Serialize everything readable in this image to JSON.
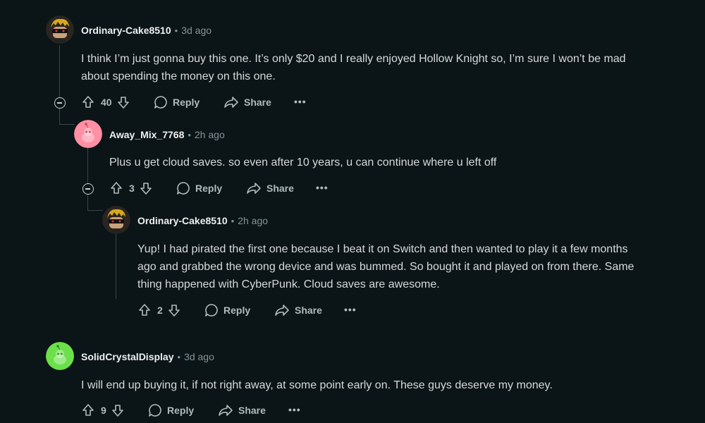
{
  "comments": [
    {
      "username": "Ordinary-Cake8510",
      "time": "3d ago",
      "lines": [
        "I think I’m just gonna buy this one. It’s only $20 and I really enjoyed Hollow Knight so, I’m sure I won’t be mad",
        "about spending the money on this one."
      ],
      "votes": "40",
      "avatar": "sunglasses-avatar"
    },
    {
      "username": "Away_Mix_7768",
      "time": "2h ago",
      "lines": [
        "Plus u get cloud saves. so even after 10 years, u can continue where u left off"
      ],
      "votes": "3",
      "avatar": "snoo-pink-avatar"
    },
    {
      "username": "Ordinary-Cake8510",
      "time": "2h ago",
      "lines": [
        "Yup! I had pirated the first one because I beat it on Switch and then wanted to play it a few months",
        "ago and grabbed the wrong device and was bummed. So bought it and played on from there. Same",
        "thing happened with CyberPunk. Cloud saves are awesome."
      ],
      "votes": "2",
      "avatar": "sunglasses-avatar"
    },
    {
      "username": "SolidCrystalDisplay",
      "time": "3d ago",
      "lines": [
        "I will end up buying it, if not right away, at some point early on. These guys deserve my money."
      ],
      "votes": "9",
      "avatar": "snoo-green-avatar"
    }
  ],
  "labels": {
    "reply": "Reply",
    "share": "Share",
    "more": "•••",
    "separator": "•"
  },
  "colors": {
    "background": "#0b1416",
    "text": "#d7dadc",
    "meta": "#82959b",
    "thread_line": "#3a4447",
    "pink_avatar": "#ff8fa3",
    "green_avatar": "#6be04a"
  }
}
